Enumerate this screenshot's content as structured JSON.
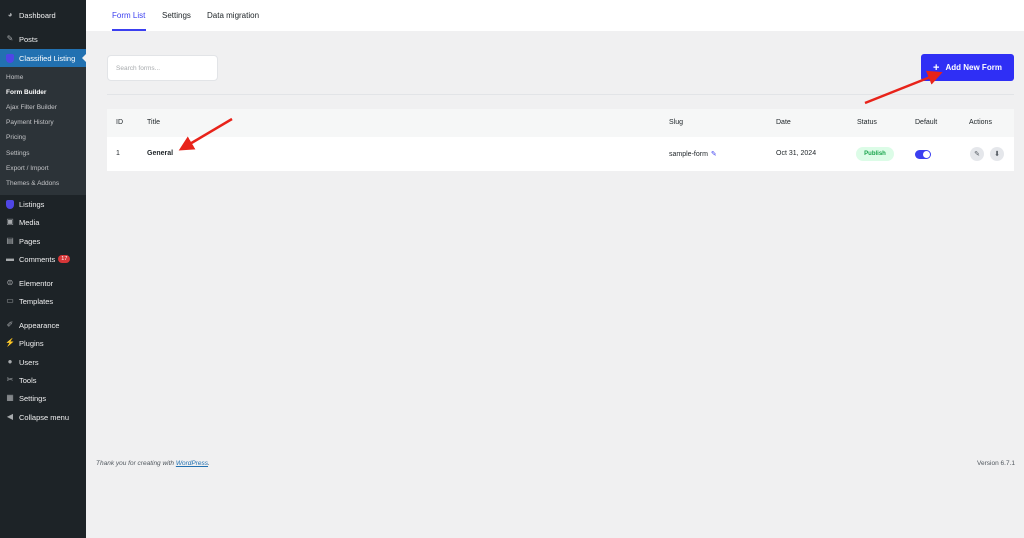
{
  "sidebar": {
    "items": [
      {
        "label": "Dashboard",
        "icon": "dashboard-icon",
        "glyph": "◕"
      },
      {
        "label": "Posts",
        "icon": "pin-icon",
        "glyph": "✎"
      },
      {
        "label": "Classified Listing",
        "icon": "shield-icon",
        "glyph": ""
      },
      {
        "label": "Listings",
        "icon": "shield-icon",
        "glyph": ""
      },
      {
        "label": "Media",
        "icon": "media-icon",
        "glyph": "▣"
      },
      {
        "label": "Pages",
        "icon": "pages-icon",
        "glyph": "▤"
      },
      {
        "label": "Comments",
        "icon": "comment-icon",
        "glyph": "▬",
        "badge": "17"
      },
      {
        "label": "Elementor",
        "icon": "elementor-icon",
        "glyph": "⊜"
      },
      {
        "label": "Templates",
        "icon": "folder-icon",
        "glyph": "▭"
      },
      {
        "label": "Appearance",
        "icon": "brush-icon",
        "glyph": "✐"
      },
      {
        "label": "Plugins",
        "icon": "plugin-icon",
        "glyph": "⚡"
      },
      {
        "label": "Users",
        "icon": "user-icon",
        "glyph": "●"
      },
      {
        "label": "Tools",
        "icon": "wrench-icon",
        "glyph": "✂"
      },
      {
        "label": "Settings",
        "icon": "settings-icon",
        "glyph": "▦"
      },
      {
        "label": "Collapse menu",
        "icon": "collapse-icon",
        "glyph": "◀"
      }
    ],
    "submenu": [
      {
        "label": "Home"
      },
      {
        "label": "Form Builder"
      },
      {
        "label": "Ajax Filter Builder"
      },
      {
        "label": "Payment History"
      },
      {
        "label": "Pricing"
      },
      {
        "label": "Settings"
      },
      {
        "label": "Export / Import"
      },
      {
        "label": "Themes & Addons"
      }
    ]
  },
  "tabs": [
    {
      "label": "Form List"
    },
    {
      "label": "Settings"
    },
    {
      "label": "Data migration"
    }
  ],
  "search": {
    "placeholder": "Search forms..."
  },
  "add_button": {
    "label": "Add New Form",
    "plus": "+"
  },
  "table": {
    "headers": {
      "id": "ID",
      "title": "Title",
      "slug": "Slug",
      "date": "Date",
      "status": "Status",
      "default": "Default",
      "actions": "Actions"
    },
    "rows": [
      {
        "id": "1",
        "title": "General",
        "slug": "sample-form",
        "date": "Oct 31, 2024",
        "status": "Publish",
        "default": true
      }
    ]
  },
  "footer": {
    "thanks_prefix": "Thank you for creating with ",
    "wp_link": "WordPress",
    "thanks_suffix": ".",
    "version": "Version 6.7.1"
  },
  "colors": {
    "accent": "#2f2ff5",
    "sidebar_bg": "#1d2327",
    "active_menu": "#2271b1",
    "arrow": "#e8231a",
    "publish_bg": "#dcfce7",
    "publish_text": "#16a34a"
  }
}
